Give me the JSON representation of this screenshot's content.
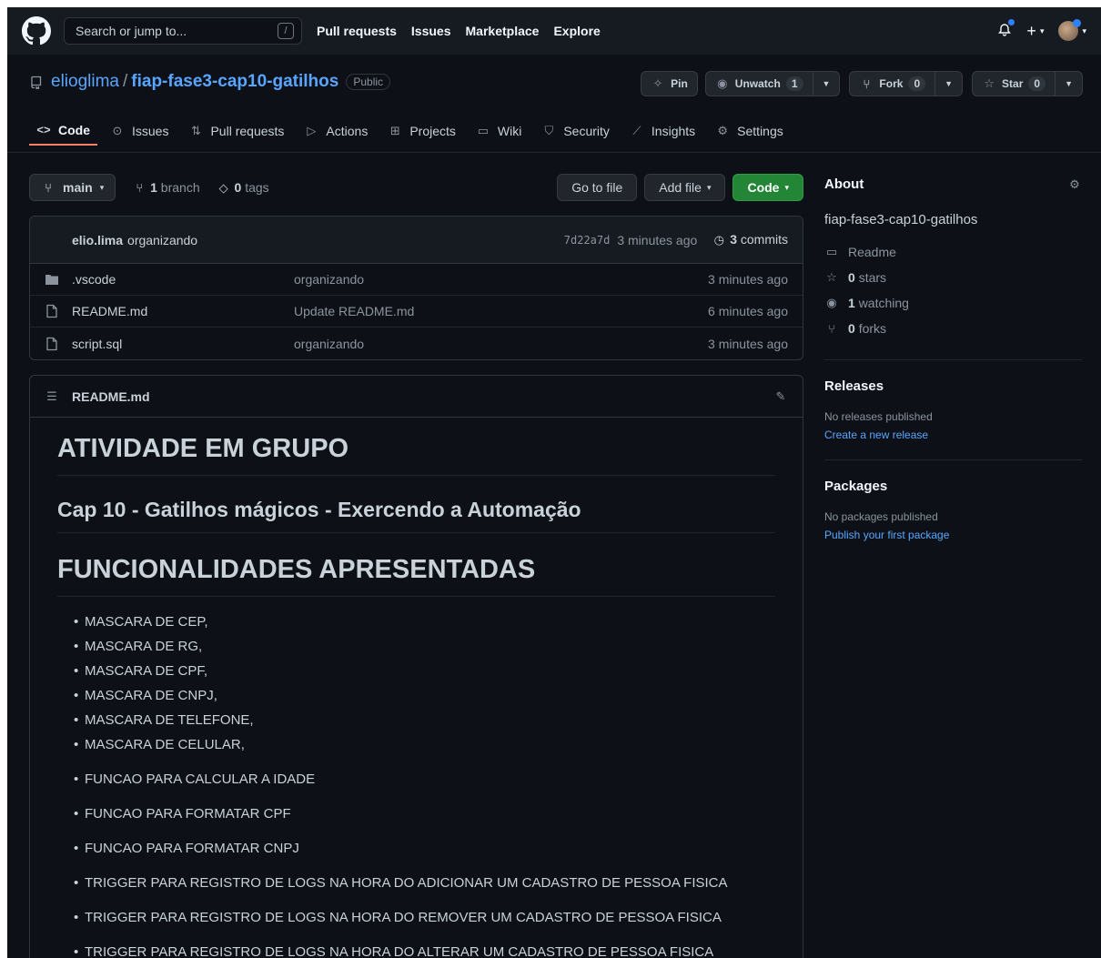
{
  "header": {
    "search_placeholder": "Search or jump to...",
    "search_shortcut": "/",
    "nav": [
      "Pull requests",
      "Issues",
      "Marketplace",
      "Explore"
    ],
    "plus_label": "+"
  },
  "repo": {
    "owner": "elioglima",
    "separator": "/",
    "name": "fiap-fase3-cap10-gatilhos",
    "visibility": "Public",
    "pin_label": "Pin",
    "unwatch_label": "Unwatch",
    "unwatch_count": "1",
    "fork_label": "Fork",
    "fork_count": "0",
    "star_label": "Star",
    "star_count": "0"
  },
  "tabs": [
    {
      "label": "Code",
      "icon": "code-icon"
    },
    {
      "label": "Issues",
      "icon": "issue-icon"
    },
    {
      "label": "Pull requests",
      "icon": "pull-request-icon"
    },
    {
      "label": "Actions",
      "icon": "play-icon"
    },
    {
      "label": "Projects",
      "icon": "table-icon"
    },
    {
      "label": "Wiki",
      "icon": "book-icon"
    },
    {
      "label": "Security",
      "icon": "shield-icon"
    },
    {
      "label": "Insights",
      "icon": "graph-icon"
    },
    {
      "label": "Settings",
      "icon": "gear-icon"
    }
  ],
  "toolbar": {
    "branch": "main",
    "branch_count": "1",
    "branch_word": "branch",
    "tag_count": "0",
    "tag_word": "tags",
    "go_to_file": "Go to file",
    "add_file": "Add file",
    "code": "Code"
  },
  "commit": {
    "author": "elio.lima",
    "message": "organizando",
    "sha": "7d22a7d",
    "age": "3 minutes ago",
    "commit_count": "3",
    "commit_word": "commits"
  },
  "files": [
    {
      "type": "folder",
      "name": ".vscode",
      "message": "organizando",
      "age": "3 minutes ago"
    },
    {
      "type": "file",
      "name": "README.md",
      "message": "Update README.md",
      "age": "6 minutes ago"
    },
    {
      "type": "file",
      "name": "script.sql",
      "message": "organizando",
      "age": "3 minutes ago"
    }
  ],
  "readme": {
    "filename": "README.md",
    "h1": "ATIVIDADE EM GRUPO",
    "h2": "Cap 10 - Gatilhos mágicos - Exercendo a Automação",
    "h1b": "FUNCIONALIDADES APRESENTADAS",
    "list_tight": [
      "MASCARA DE CEP,",
      "MASCARA DE RG,",
      "MASCARA DE CPF,",
      "MASCARA DE CNPJ,",
      "MASCARA DE TELEFONE,",
      "MASCARA DE CELULAR,"
    ],
    "list_loose": [
      "FUNCAO PARA CALCULAR A IDADE",
      "FUNCAO PARA FORMATAR CPF",
      "FUNCAO PARA FORMATAR CNPJ",
      "TRIGGER PARA REGISTRO DE LOGS NA HORA DO ADICIONAR UM CADASTRO DE PESSOA FISICA",
      "TRIGGER PARA REGISTRO DE LOGS NA HORA DO REMOVER UM CADASTRO DE PESSOA FISICA",
      "TRIGGER PARA REGISTRO DE LOGS NA HORA DO ALTERAR UM CADASTRO DE PESSOA FISICA"
    ]
  },
  "about": {
    "title": "About",
    "description": "fiap-fase3-cap10-gatilhos",
    "readme": "Readme",
    "stars_count": "0",
    "stars_word": "stars",
    "watching_count": "1",
    "watching_word": "watching",
    "forks_count": "0",
    "forks_word": "forks"
  },
  "releases": {
    "title": "Releases",
    "empty": "No releases published",
    "link": "Create a new release"
  },
  "packages": {
    "title": "Packages",
    "empty": "No packages published",
    "link": "Publish your first package"
  },
  "colors": {
    "background": "#0d1117",
    "header": "#161b22",
    "link": "#58a6ff",
    "green_button": "#238636",
    "active_tab": "#f78166",
    "notification": "#2f81f7"
  }
}
